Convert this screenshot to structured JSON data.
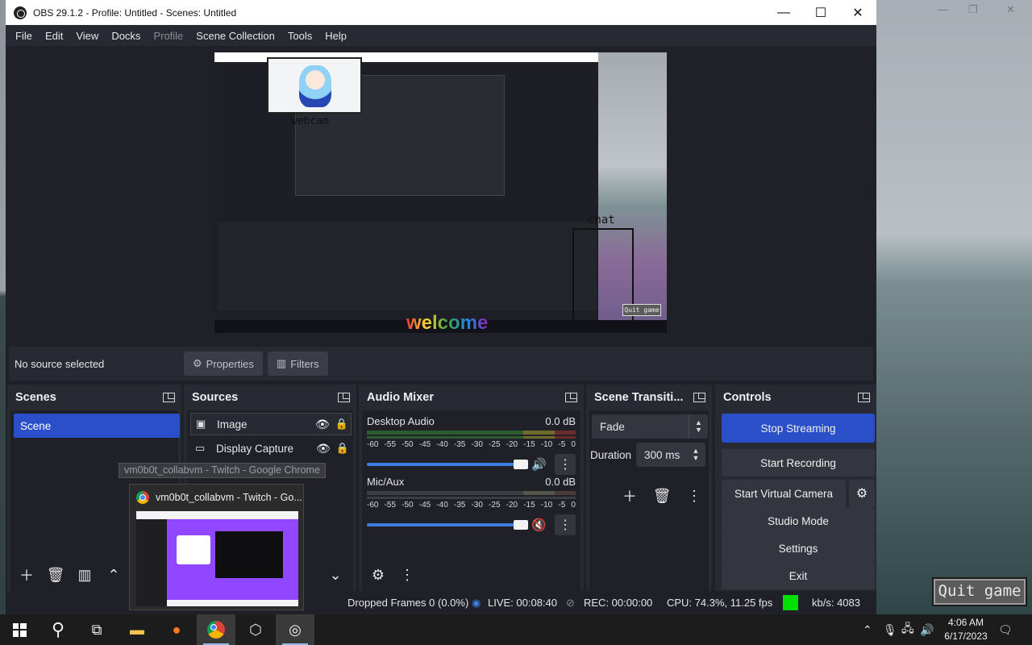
{
  "window": {
    "title": "OBS 29.1.2 - Profile: Untitled - Scenes: Untitled",
    "minimize": "—",
    "maximize": "☐",
    "close": "✕"
  },
  "menu": [
    "File",
    "Edit",
    "View",
    "Docks",
    "Profile",
    "Scene Collection",
    "Tools",
    "Help"
  ],
  "preview": {
    "webcam_label": "webcam",
    "chat_label": "chat",
    "welcome_text": "welcome",
    "inner_quit": "Quit game"
  },
  "source_toolbar": {
    "no_source": "No source selected",
    "properties": "Properties",
    "filters": "Filters"
  },
  "scenes": {
    "title": "Scenes",
    "items": [
      "Scene"
    ]
  },
  "sources": {
    "title": "Sources",
    "items": [
      {
        "name": "Image",
        "icon": "image-icon"
      },
      {
        "name": "Display Capture",
        "icon": "monitor-icon"
      }
    ]
  },
  "audio_mixer": {
    "title": "Audio Mixer",
    "scale": [
      "-60",
      "-55",
      "-50",
      "-45",
      "-40",
      "-35",
      "-30",
      "-25",
      "-20",
      "-15",
      "-10",
      "-5",
      "0"
    ],
    "channels": [
      {
        "name": "Desktop Audio",
        "db": "0.0 dB",
        "muted": false
      },
      {
        "name": "Mic/Aux",
        "db": "0.0 dB",
        "muted": true
      }
    ]
  },
  "transitions": {
    "title": "Scene Transiti...",
    "selected": "Fade",
    "duration_label": "Duration",
    "duration_value": "300 ms"
  },
  "controls": {
    "title": "Controls",
    "stop_streaming": "Stop Streaming",
    "start_recording": "Start Recording",
    "start_virtual_camera": "Start Virtual Camera",
    "studio_mode": "Studio Mode",
    "settings": "Settings",
    "exit": "Exit"
  },
  "status": {
    "dropped_frames": "Dropped Frames 0 (0.0%)",
    "live": "LIVE: 00:08:40",
    "rec": "REC: 00:00:00",
    "cpu": "CPU: 74.3%, 11.25 fps",
    "kbs": "kb/s: 4083",
    "indicator_color": "#00e000"
  },
  "chrome_popup": {
    "tooltip": "vm0b0t_collabvm - Twitch - Google Chrome",
    "title": "vm0b0t_collabvm - Twitch - Go..."
  },
  "game": {
    "quit_button": "Quit game"
  },
  "taskbar": {
    "time": "4:06 AM",
    "date": "6/17/2023"
  },
  "colors": {
    "accent": "#2a4fc9",
    "panel": "#272a33",
    "background": "#1f2028"
  }
}
